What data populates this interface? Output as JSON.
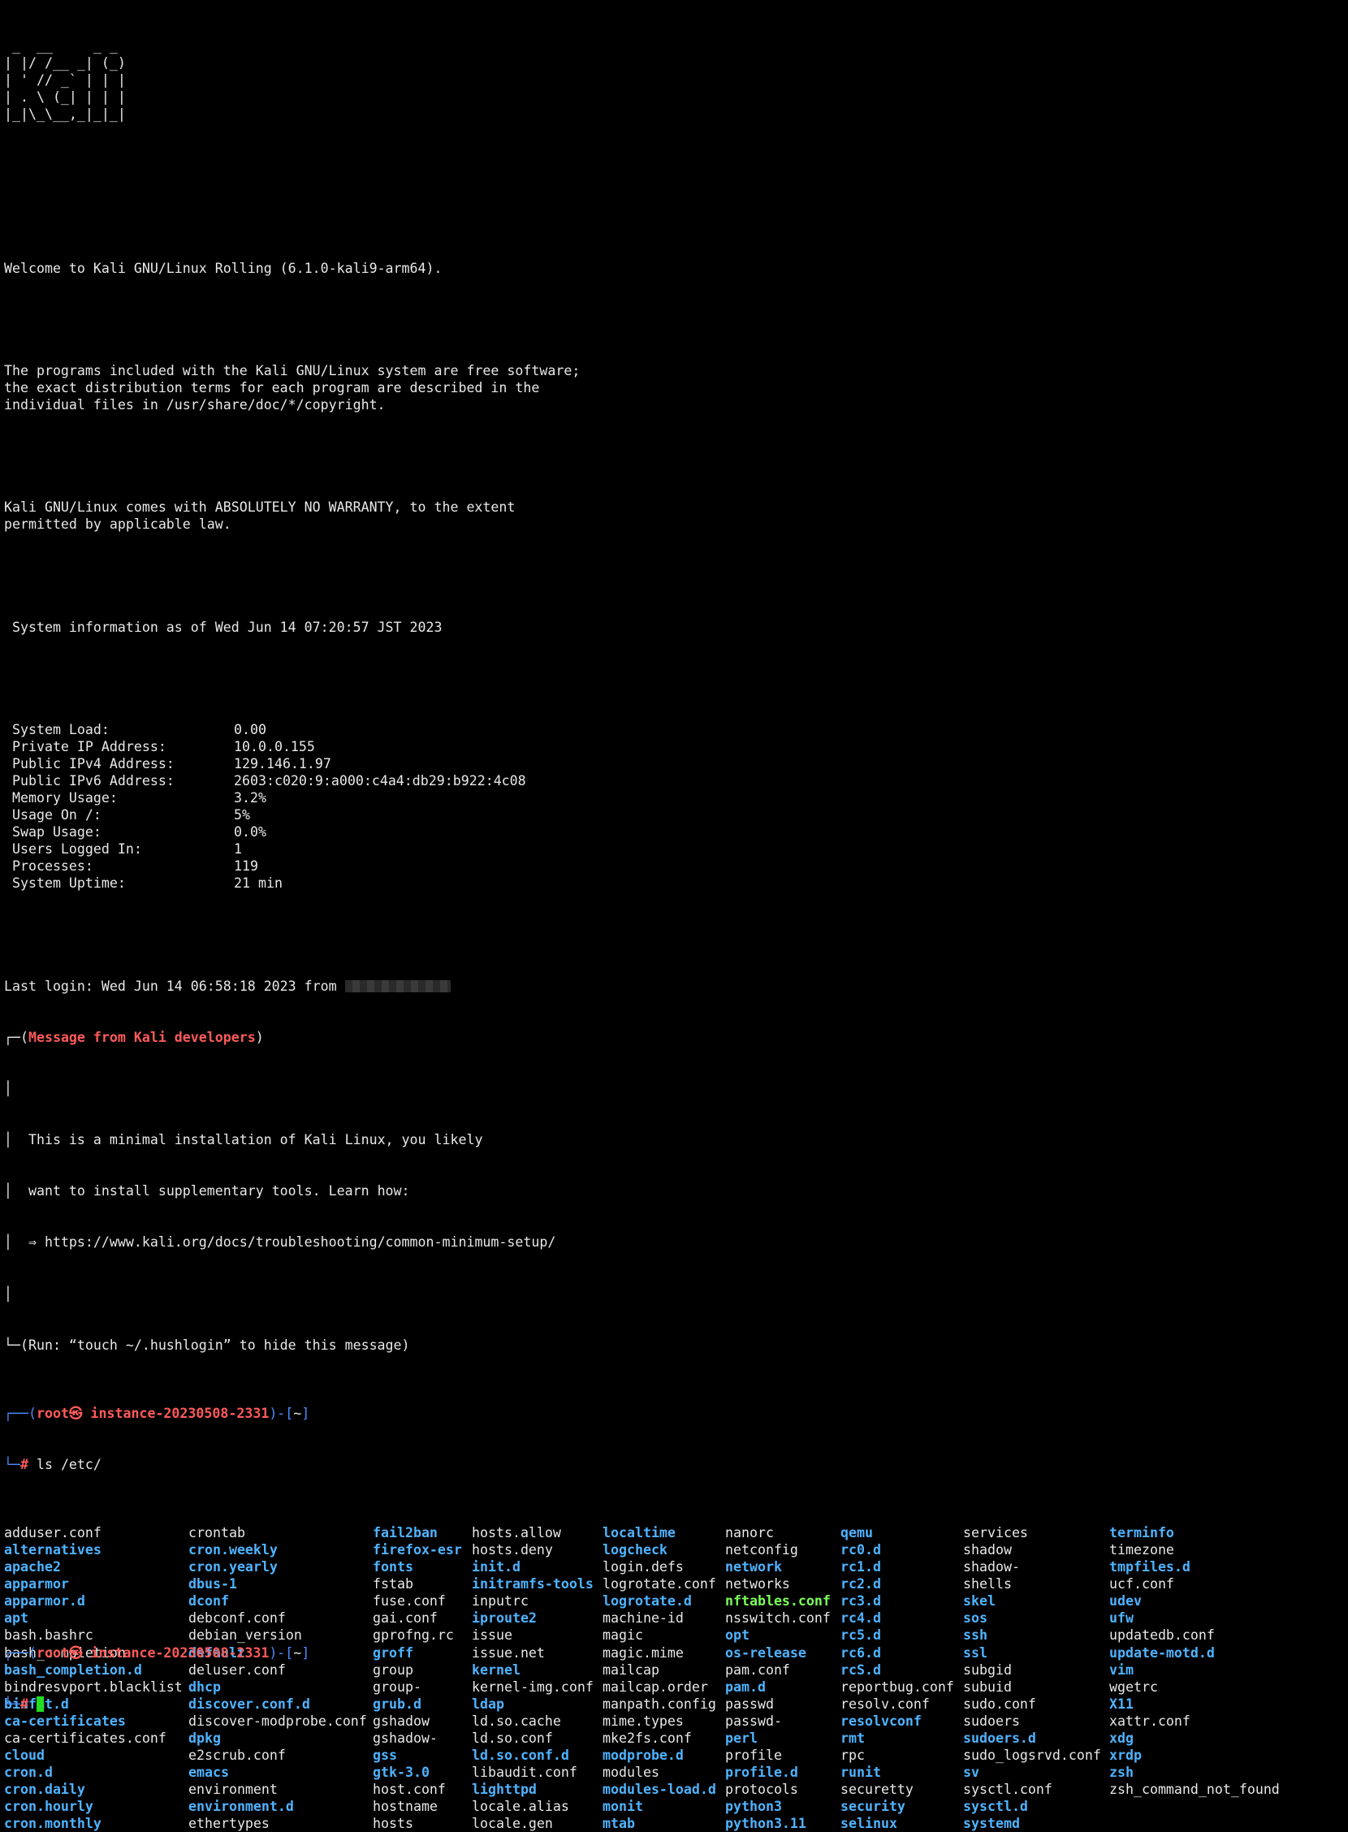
{
  "banner": [
    " _  __     _ _",
    "| |/ /__ _| (_)",
    "| ' // _` | | |",
    "| . \\ (_| | | |",
    "|_|\\_\\__,_|_|_|"
  ],
  "welcome": "Welcome to Kali GNU/Linux Rolling (6.1.0-kali9-arm64).",
  "license": [
    "The programs included with the Kali GNU/Linux system are free software;",
    "the exact distribution terms for each program are described in the",
    "individual files in /usr/share/doc/*/copyright."
  ],
  "warranty": [
    "Kali GNU/Linux comes with ABSOLUTELY NO WARRANTY, to the extent",
    "permitted by applicable law."
  ],
  "sysinfo_header": " System information as of Wed Jun 14 07:20:57 JST 2023",
  "sysinfo": [
    {
      "k": " System Load:",
      "v": "0.00"
    },
    {
      "k": " Private IP Address:",
      "v": "10.0.0.155"
    },
    {
      "k": " Public IPv4 Address:",
      "v": "129.146.1.97"
    },
    {
      "k": " Public IPv6 Address:",
      "v": "2603:c020:9:a000:c4a4:db29:b922:4c08"
    },
    {
      "k": " Memory Usage:",
      "v": "3.2%"
    },
    {
      "k": " Usage On /:",
      "v": "5%"
    },
    {
      "k": " Swap Usage:",
      "v": "0.0%"
    },
    {
      "k": " Users Logged In:",
      "v": "1"
    },
    {
      "k": " Processes:",
      "v": "119"
    },
    {
      "k": " System Uptime:",
      "v": "21 min"
    }
  ],
  "last_login": "Last login: Wed Jun 14 06:58:18 2023 from ",
  "msg_box": {
    "top_prefix": "┌─(",
    "title": "Message from Kali developers",
    "top_suffix": ")",
    "side": "│",
    "lines": [
      "  This is a minimal installation of Kali Linux, you likely",
      "  want to install supplementary tools. Learn how:",
      "  ⇒ https://www.kali.org/docs/troubleshooting/common-minimum-setup/"
    ],
    "bottom": "└─(Run: “touch ~/.hushlogin” to hide this message)"
  },
  "prompt": {
    "p1": "┌──(",
    "user": "root",
    "at": "㉿",
    "host": " instance-20230508-2331",
    "p2": ")-[",
    "dir": "~",
    "p3": "]",
    "l2": "└─",
    "hash": "#",
    "cmd": " ls /etc/"
  },
  "ls_columns": [
    [
      [
        "adduser.conf",
        ""
      ],
      [
        "alternatives",
        "blue"
      ],
      [
        "apache2",
        "blue"
      ],
      [
        "apparmor",
        "blue"
      ],
      [
        "apparmor.d",
        "blue"
      ],
      [
        "apt",
        "blue"
      ],
      [
        "bash.bashrc",
        ""
      ],
      [
        "bash_completion",
        ""
      ],
      [
        "bash_completion.d",
        "blue"
      ],
      [
        "bindresvport.blacklist",
        ""
      ],
      [
        "binfmt.d",
        "blue"
      ],
      [
        "ca-certificates",
        "blue"
      ],
      [
        "ca-certificates.conf",
        ""
      ],
      [
        "cloud",
        "blue"
      ],
      [
        "cron.d",
        "blue"
      ],
      [
        "cron.daily",
        "blue"
      ],
      [
        "cron.hourly",
        "blue"
      ],
      [
        "cron.monthly",
        "blue"
      ]
    ],
    [
      [
        "crontab",
        ""
      ],
      [
        "cron.weekly",
        "blue"
      ],
      [
        "cron.yearly",
        "blue"
      ],
      [
        "dbus-1",
        "blue"
      ],
      [
        "dconf",
        "blue"
      ],
      [
        "debconf.conf",
        ""
      ],
      [
        "debian_version",
        ""
      ],
      [
        "default",
        "blue"
      ],
      [
        "deluser.conf",
        ""
      ],
      [
        "dhcp",
        "blue"
      ],
      [
        "discover.conf.d",
        "blue"
      ],
      [
        "discover-modprobe.conf",
        ""
      ],
      [
        "dpkg",
        "blue"
      ],
      [
        "e2scrub.conf",
        ""
      ],
      [
        "emacs",
        "blue"
      ],
      [
        "environment",
        ""
      ],
      [
        "environment.d",
        "blue"
      ],
      [
        "ethertypes",
        ""
      ]
    ],
    [
      [
        "fail2ban",
        "blue"
      ],
      [
        "firefox-esr",
        "blue"
      ],
      [
        "fonts",
        "blue"
      ],
      [
        "fstab",
        ""
      ],
      [
        "fuse.conf",
        ""
      ],
      [
        "gai.conf",
        ""
      ],
      [
        "gprofng.rc",
        ""
      ],
      [
        "groff",
        "blue"
      ],
      [
        "group",
        ""
      ],
      [
        "group-",
        ""
      ],
      [
        "grub.d",
        "blue"
      ],
      [
        "gshadow",
        ""
      ],
      [
        "gshadow-",
        ""
      ],
      [
        "gss",
        "blue"
      ],
      [
        "gtk-3.0",
        "blue"
      ],
      [
        "host.conf",
        ""
      ],
      [
        "hostname",
        ""
      ],
      [
        "hosts",
        ""
      ]
    ],
    [
      [
        "hosts.allow",
        ""
      ],
      [
        "hosts.deny",
        ""
      ],
      [
        "init.d",
        "blue"
      ],
      [
        "initramfs-tools",
        "blue"
      ],
      [
        "inputrc",
        ""
      ],
      [
        "iproute2",
        "blue"
      ],
      [
        "issue",
        ""
      ],
      [
        "issue.net",
        ""
      ],
      [
        "kernel",
        "blue"
      ],
      [
        "kernel-img.conf",
        ""
      ],
      [
        "ldap",
        "blue"
      ],
      [
        "ld.so.cache",
        ""
      ],
      [
        "ld.so.conf",
        ""
      ],
      [
        "ld.so.conf.d",
        "blue"
      ],
      [
        "libaudit.conf",
        ""
      ],
      [
        "lighttpd",
        "blue"
      ],
      [
        "locale.alias",
        ""
      ],
      [
        "locale.gen",
        ""
      ]
    ],
    [
      [
        "localtime",
        "blue"
      ],
      [
        "logcheck",
        "blue"
      ],
      [
        "login.defs",
        ""
      ],
      [
        "logrotate.conf",
        ""
      ],
      [
        "logrotate.d",
        "blue"
      ],
      [
        "machine-id",
        ""
      ],
      [
        "magic",
        ""
      ],
      [
        "magic.mime",
        ""
      ],
      [
        "mailcap",
        ""
      ],
      [
        "mailcap.order",
        ""
      ],
      [
        "manpath.config",
        ""
      ],
      [
        "mime.types",
        ""
      ],
      [
        "mke2fs.conf",
        ""
      ],
      [
        "modprobe.d",
        "blue"
      ],
      [
        "modules",
        ""
      ],
      [
        "modules-load.d",
        "blue"
      ],
      [
        "monit",
        "blue"
      ],
      [
        "mtab",
        "blue"
      ]
    ],
    [
      [
        "nanorc",
        ""
      ],
      [
        "netconfig",
        ""
      ],
      [
        "network",
        "blue"
      ],
      [
        "networks",
        ""
      ],
      [
        "nftables.conf",
        "green"
      ],
      [
        "nsswitch.conf",
        ""
      ],
      [
        "opt",
        "blue"
      ],
      [
        "os-release",
        "blue"
      ],
      [
        "pam.conf",
        ""
      ],
      [
        "pam.d",
        "blue"
      ],
      [
        "passwd",
        ""
      ],
      [
        "passwd-",
        ""
      ],
      [
        "perl",
        "blue"
      ],
      [
        "profile",
        ""
      ],
      [
        "profile.d",
        "blue"
      ],
      [
        "protocols",
        ""
      ],
      [
        "python3",
        "blue"
      ],
      [
        "python3.11",
        "blue"
      ]
    ],
    [
      [
        "qemu",
        "blue"
      ],
      [
        "rc0.d",
        "blue"
      ],
      [
        "rc1.d",
        "blue"
      ],
      [
        "rc2.d",
        "blue"
      ],
      [
        "rc3.d",
        "blue"
      ],
      [
        "rc4.d",
        "blue"
      ],
      [
        "rc5.d",
        "blue"
      ],
      [
        "rc6.d",
        "blue"
      ],
      [
        "rcS.d",
        "blue"
      ],
      [
        "reportbug.conf",
        ""
      ],
      [
        "resolv.conf",
        ""
      ],
      [
        "resolvconf",
        "blue"
      ],
      [
        "rmt",
        "blue"
      ],
      [
        "rpc",
        ""
      ],
      [
        "runit",
        "blue"
      ],
      [
        "securetty",
        ""
      ],
      [
        "security",
        "blue"
      ],
      [
        "selinux",
        "blue"
      ]
    ],
    [
      [
        "services",
        ""
      ],
      [
        "shadow",
        ""
      ],
      [
        "shadow-",
        ""
      ],
      [
        "shells",
        ""
      ],
      [
        "skel",
        "blue"
      ],
      [
        "sos",
        "blue"
      ],
      [
        "ssh",
        "blue"
      ],
      [
        "ssl",
        "blue"
      ],
      [
        "subgid",
        ""
      ],
      [
        "subuid",
        ""
      ],
      [
        "sudo.conf",
        ""
      ],
      [
        "sudoers",
        ""
      ],
      [
        "sudoers.d",
        "blue"
      ],
      [
        "sudo_logsrvd.conf",
        ""
      ],
      [
        "sv",
        "blue"
      ],
      [
        "sysctl.conf",
        ""
      ],
      [
        "sysctl.d",
        "blue"
      ],
      [
        "systemd",
        "blue"
      ]
    ],
    [
      [
        "terminfo",
        "blue"
      ],
      [
        "timezone",
        ""
      ],
      [
        "tmpfiles.d",
        "blue"
      ],
      [
        "ucf.conf",
        ""
      ],
      [
        "udev",
        "blue"
      ],
      [
        "ufw",
        "blue"
      ],
      [
        "updatedb.conf",
        ""
      ],
      [
        "update-motd.d",
        "blue"
      ],
      [
        "vim",
        "blue"
      ],
      [
        "wgetrc",
        ""
      ],
      [
        "X11",
        "blue"
      ],
      [
        "xattr.conf",
        ""
      ],
      [
        "xdg",
        "blue"
      ],
      [
        "xrdp",
        "blue"
      ],
      [
        "zsh",
        "blue"
      ],
      [
        "zsh_command_not_found",
        ""
      ]
    ]
  ],
  "colors": {
    "background": "#000000",
    "text": "#e8e8e8",
    "dir": "#4fb3ff",
    "exec": "#7cff5a",
    "root": "#ff5a5a",
    "cursor": "#22dd22"
  }
}
